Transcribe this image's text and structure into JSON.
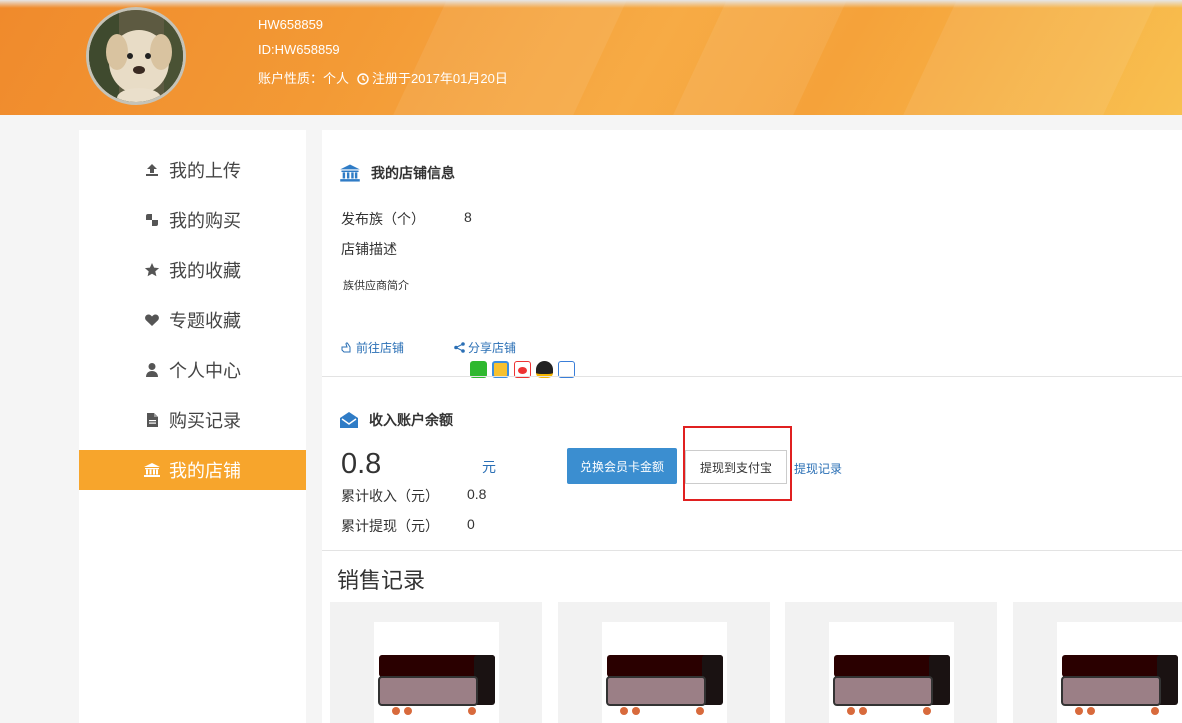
{
  "header": {
    "username": "HW658859",
    "user_id": "ID:HW658859",
    "account_type": "账户性质：个人",
    "registered": "注册于2017年01月20日"
  },
  "sidebar": {
    "items": [
      {
        "label": "我的上传",
        "icon": "upload-icon"
      },
      {
        "label": "我的购买",
        "icon": "purchase-icon"
      },
      {
        "label": "我的收藏",
        "icon": "star-icon"
      },
      {
        "label": "专题收藏",
        "icon": "heart-icon"
      },
      {
        "label": "个人中心",
        "icon": "user-icon"
      },
      {
        "label": "购买记录",
        "icon": "file-icon"
      },
      {
        "label": "我的店铺",
        "icon": "bank-icon",
        "active": true
      }
    ],
    "active_color": "#f7a52c"
  },
  "shop": {
    "title": "我的店铺信息",
    "published_label": "发布族（个）",
    "published_value": "8",
    "desc_label": "店铺描述",
    "desc_value": "族供应商简介",
    "goto_label": "前往店铺",
    "share_label": "分享店铺",
    "share_icons": [
      "wechat-icon",
      "qzone-icon",
      "weibo-icon",
      "qq-icon",
      "tieba-icon"
    ]
  },
  "income": {
    "title": "收入账户余额",
    "balance": "0.8",
    "unit": "元",
    "exchange_label": "兑换会员卡金额",
    "withdraw_label": "提现到支付宝",
    "history_label": "提现记录",
    "total_income_label": "累计收入（元）",
    "total_income_value": "0.8",
    "total_withdraw_label": "累计提现（元）",
    "total_withdraw_value": "0"
  },
  "sales": {
    "title": "销售记录",
    "cards": 4
  },
  "colors": {
    "primary_button": "#3b8ed0",
    "link": "#2a6fb5",
    "highlight": "#e02020"
  }
}
